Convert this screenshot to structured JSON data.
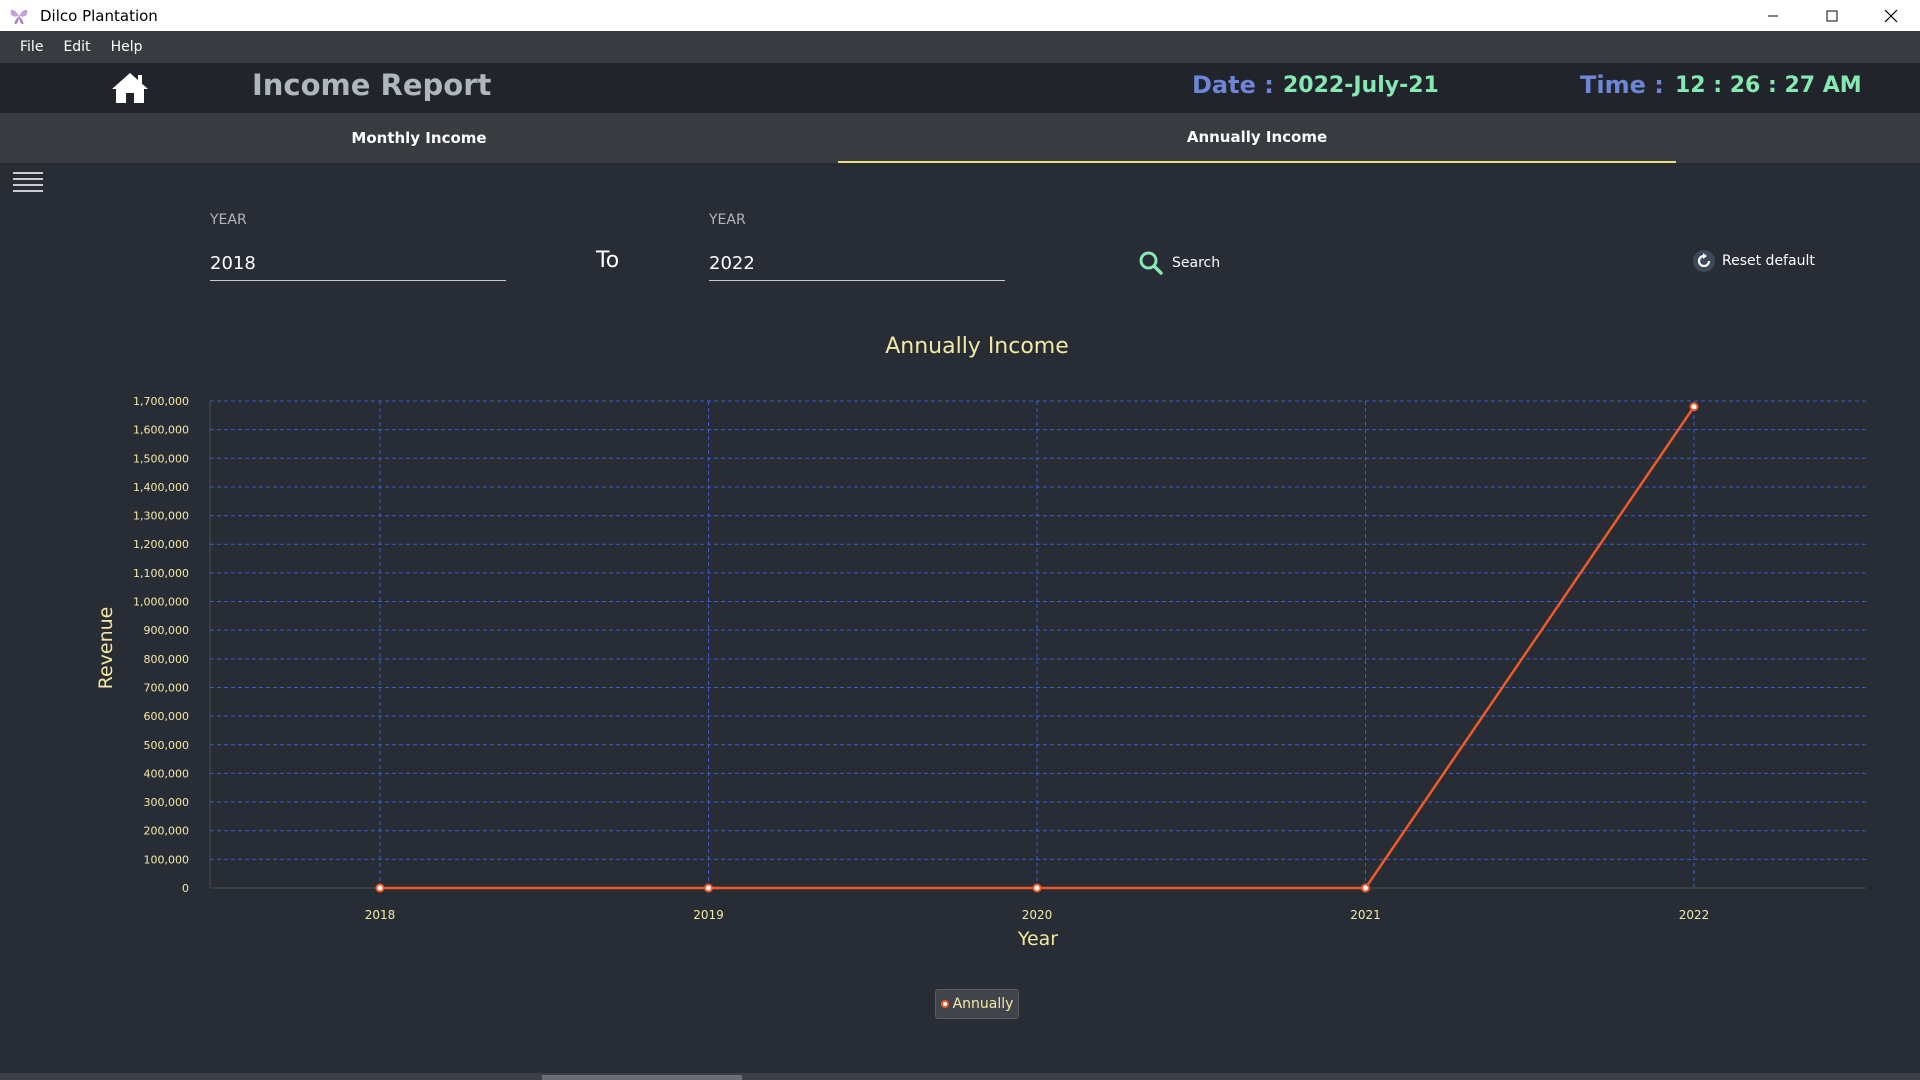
{
  "window": {
    "title": "Dilco Plantation"
  },
  "menu": {
    "file": "File",
    "edit": "Edit",
    "help": "Help"
  },
  "header": {
    "title": "Income Report",
    "date_label": "Date :",
    "date_value": "2022-July-21",
    "time_label": "Time :",
    "time_value": "12 : 26 : 27 AM"
  },
  "tabs": [
    {
      "label": "Monthly Income",
      "active": false
    },
    {
      "label": "Annually Income",
      "active": true
    }
  ],
  "filters": {
    "from_label": "YEAR",
    "from_value": "2018",
    "to_text": "To",
    "to_label": "YEAR",
    "to_value": "2022",
    "search_label": "Search",
    "reset_label": "Reset default"
  },
  "colors": {
    "accent_tab": "#e8e07c",
    "line": "#f05a2a",
    "grid": "#3d5bd0",
    "chart_text": "#f3e9a6",
    "icon_green": "#86e8b3"
  },
  "chart_data": {
    "type": "line",
    "title": "Annually Income",
    "xlabel": "Year",
    "ylabel": "Revenue",
    "categories": [
      "2018",
      "2019",
      "2020",
      "2021",
      "2022"
    ],
    "series": [
      {
        "name": "Annually",
        "values": [
          0,
          0,
          0,
          0,
          1680000
        ]
      }
    ],
    "ylim": [
      0,
      1700000
    ],
    "yticks": [
      0,
      100000,
      200000,
      300000,
      400000,
      500000,
      600000,
      700000,
      800000,
      900000,
      1000000,
      1100000,
      1200000,
      1300000,
      1400000,
      1500000,
      1600000,
      1700000
    ],
    "grid": true,
    "legend_position": "bottom-center"
  }
}
